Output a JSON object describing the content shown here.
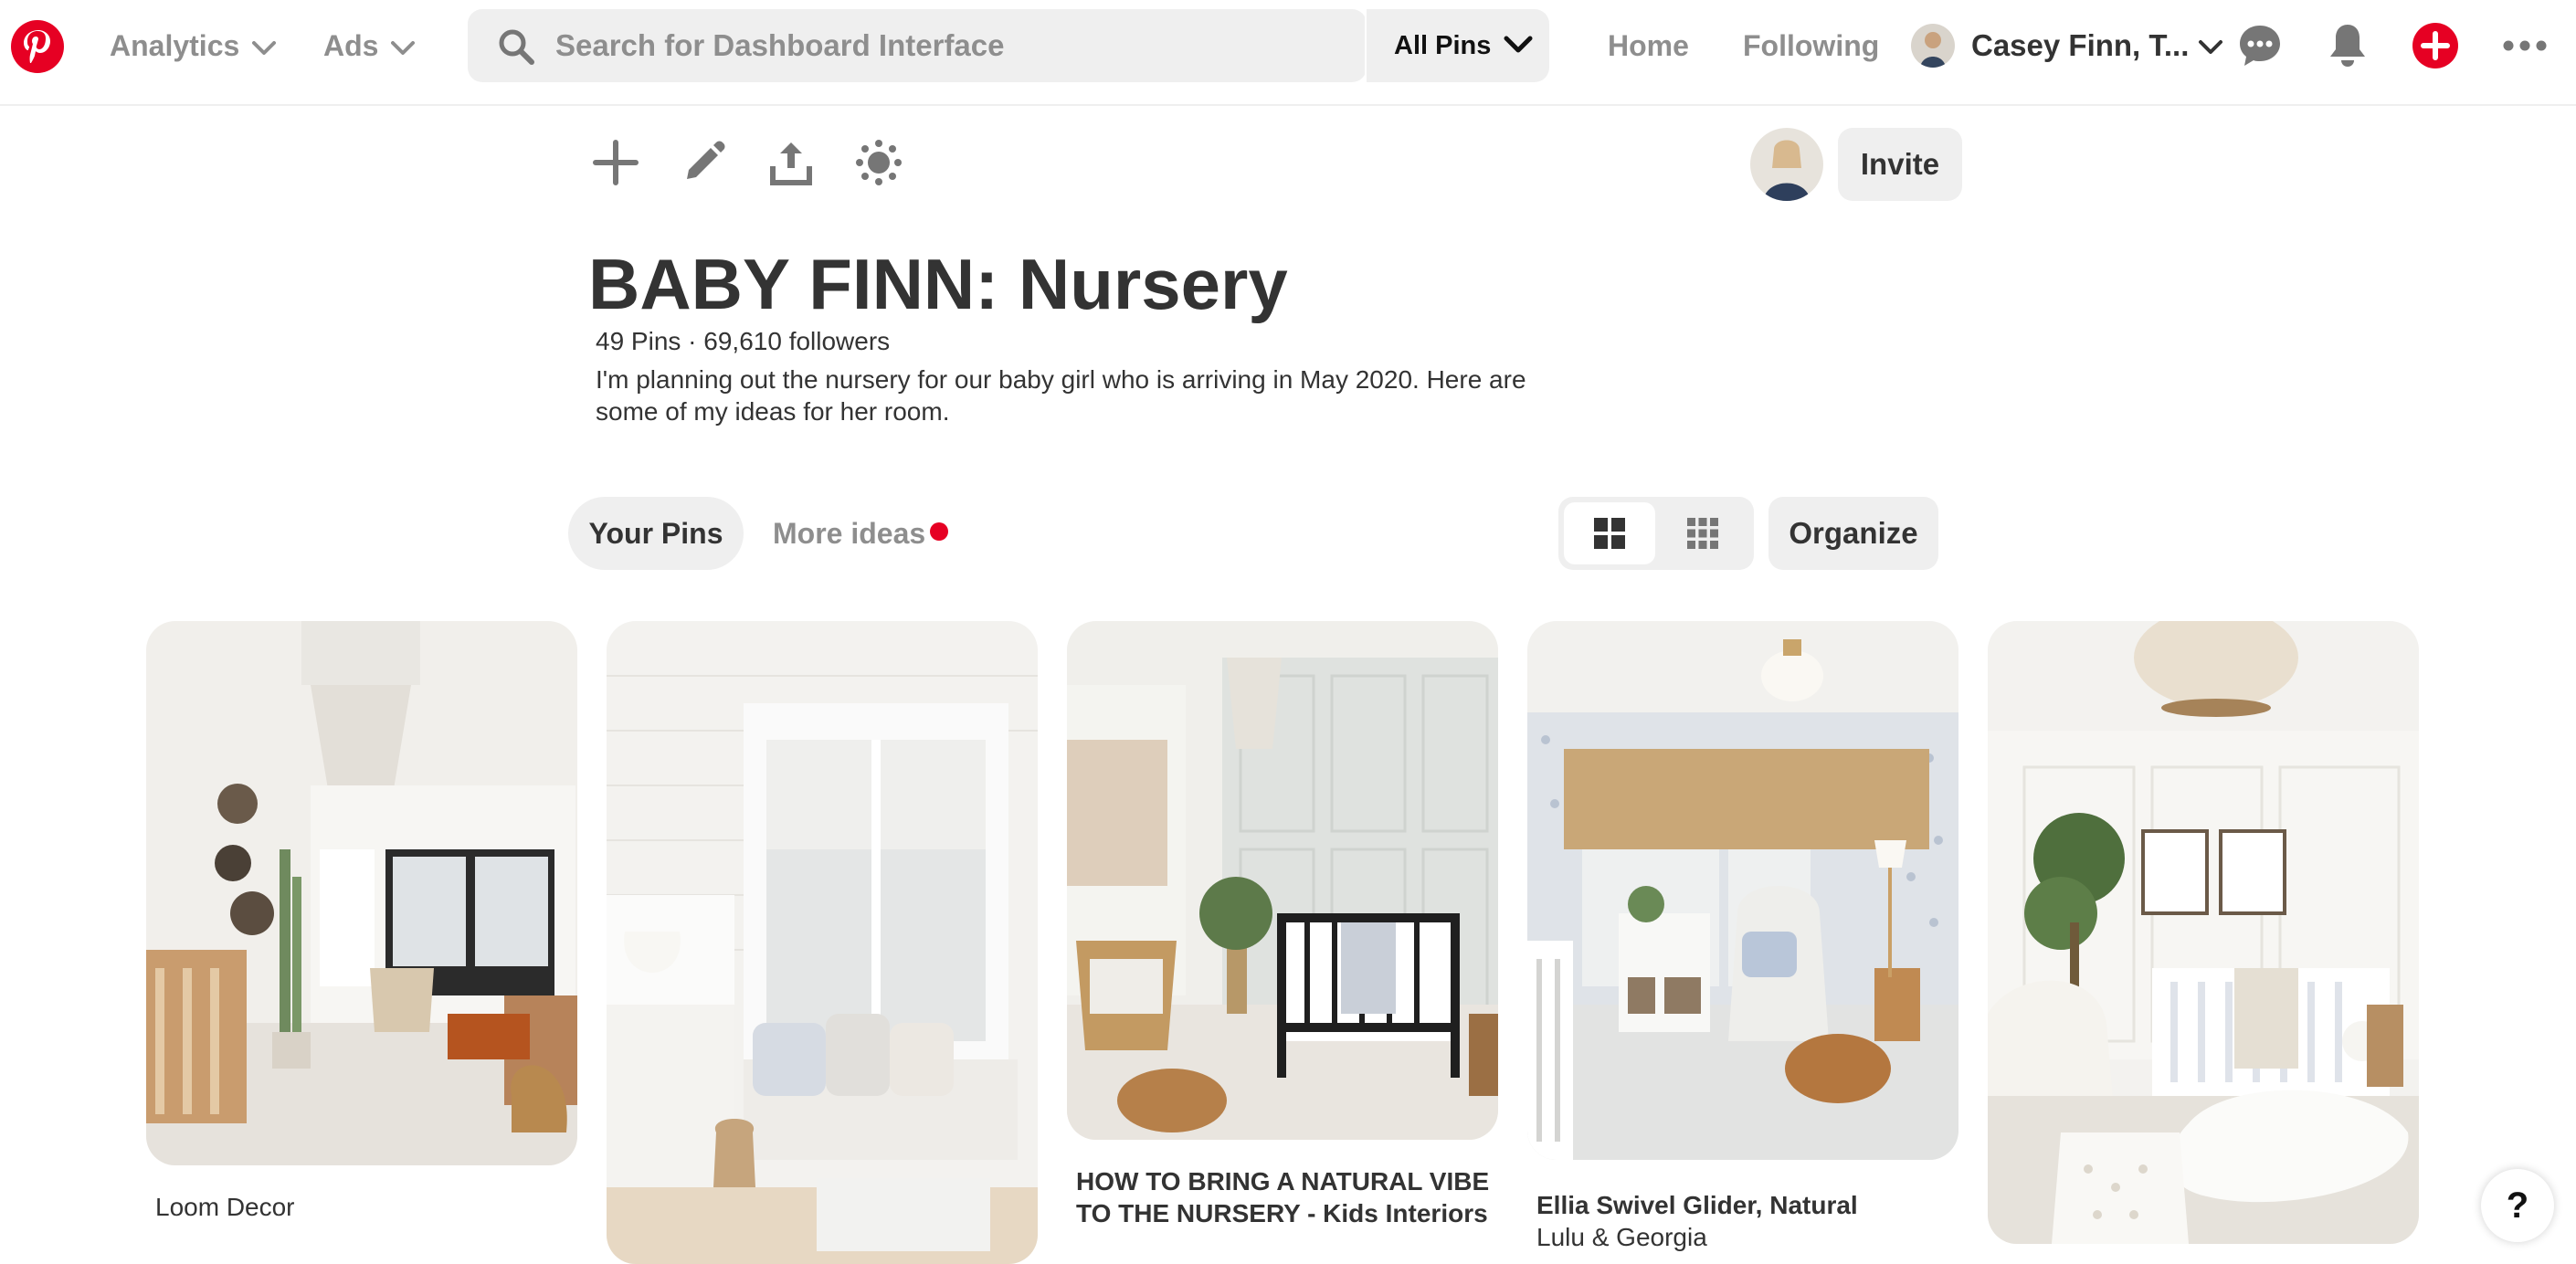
{
  "nav": {
    "analytics_label": "Analytics",
    "ads_label": "Ads",
    "search_placeholder": "Search for Dashboard Interface",
    "scope_label": "All Pins",
    "home_label": "Home",
    "following_label": "Following",
    "profile_name": "Casey Finn, T...",
    "brand_color": "#e60023"
  },
  "board": {
    "title": "BABY FINN: Nursery",
    "stats": "49 Pins · 69,610 followers",
    "description": "I'm planning out the nursery for our baby girl who is arriving in May 2020. Here are some of my ideas for her room.",
    "invite_label": "Invite"
  },
  "tabs": {
    "your_pins": "Your Pins",
    "more_ideas": "More ideas"
  },
  "controls": {
    "organize_label": "Organize"
  },
  "pins": [
    {
      "title": "Loom Decor",
      "subtitle": ""
    },
    {
      "title": "",
      "subtitle": ""
    },
    {
      "title": "HOW TO BRING A NATURAL VIBE TO THE NURSERY - Kids Interiors",
      "subtitle": ""
    },
    {
      "title": "Ellia Swivel Glider, Natural",
      "subtitle": "Lulu & Georgia"
    },
    {
      "title": "",
      "subtitle": ""
    }
  ],
  "help_label": "?"
}
